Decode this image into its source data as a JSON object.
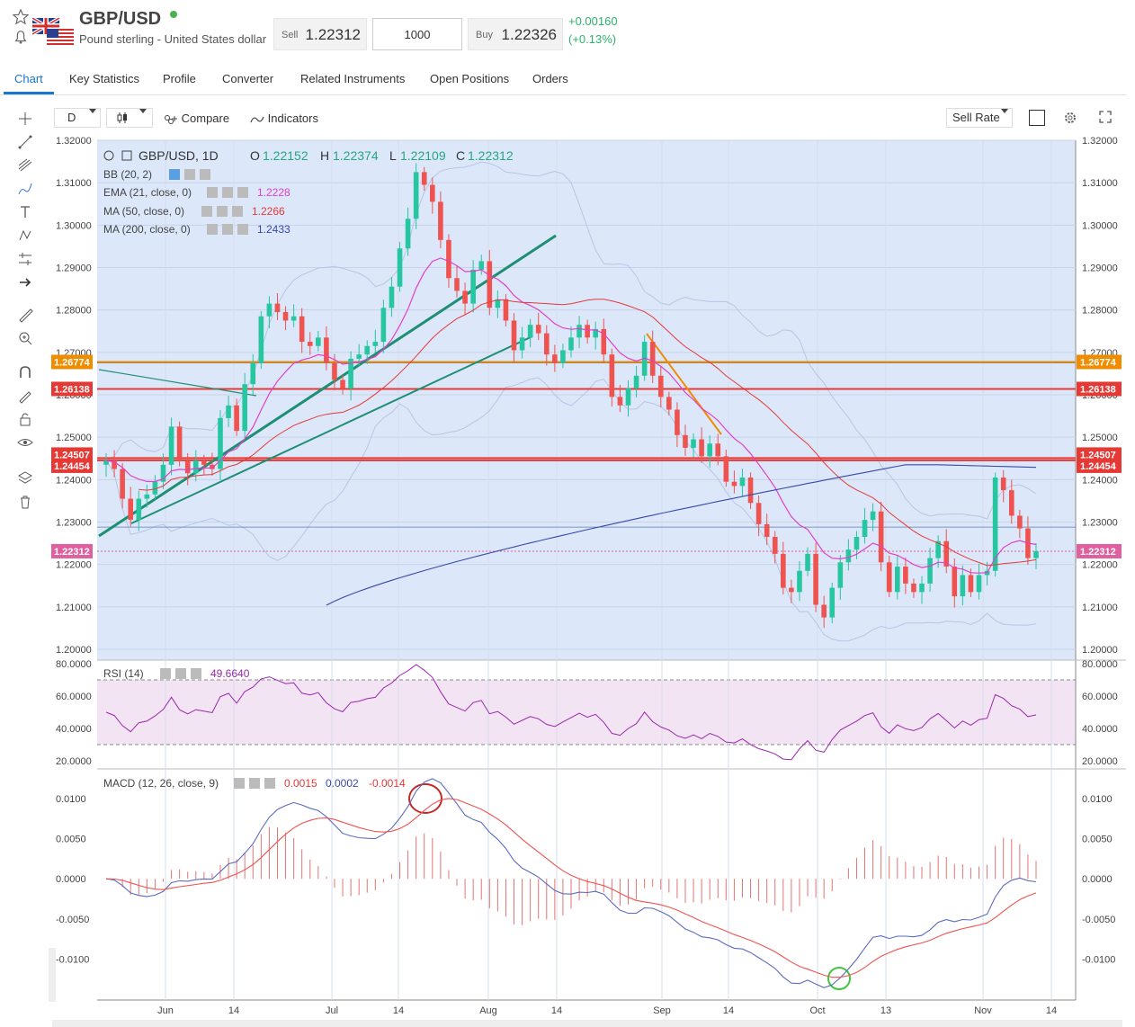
{
  "header": {
    "symbol": "GBP/USD",
    "name": "Pound sterling - United States dollar",
    "sell_label": "Sell",
    "sell_price": "1.22312",
    "quantity": "1000",
    "buy_label": "Buy",
    "buy_price": "1.22326",
    "change_abs": "+0.00160",
    "change_pct": "(+0.13%)"
  },
  "tabs": [
    {
      "label": "Chart",
      "active": true
    },
    {
      "label": "Key Statistics"
    },
    {
      "label": "Profile"
    },
    {
      "label": "Converter"
    },
    {
      "label": "Related Instruments"
    },
    {
      "label": "Open Positions"
    },
    {
      "label": "Orders"
    }
  ],
  "toolbar": {
    "interval": "D",
    "compare": "Compare",
    "indicators": "Indicators",
    "rate_mode": "Sell Rate"
  },
  "legend": {
    "title": "GBP/USD, 1D",
    "o_lbl": "O",
    "o": "1.22152",
    "h_lbl": "H",
    "h": "1.22374",
    "l_lbl": "L",
    "l": "1.22109",
    "c_lbl": "C",
    "c": "1.22312",
    "bb": "BB (20, 2)",
    "ema": "EMA (21, close, 0)",
    "ema_val": "1.2228",
    "ma50": "MA (50, close, 0)",
    "ma50_val": "1.2266",
    "ma200": "MA (200, close, 0)",
    "ma200_val": "1.2433",
    "rsi": "RSI (14)",
    "rsi_val": "49.6640",
    "macd": "MACD (12, 26, close, 9)",
    "macd_v1": "0.0015",
    "macd_v2": "0.0002",
    "macd_v3": "-0.0014"
  },
  "colors": {
    "up": "#26c6a0",
    "down": "#ef5350",
    "ema": "#e040c8",
    "ma50": "#e53935",
    "ma200": "#3949ab",
    "level_orange": "#ef8c00",
    "level_red": "#e53935",
    "trend": "#1e8f73"
  },
  "price_levels": [
    {
      "value": "1.26774",
      "color": "#ef8c00"
    },
    {
      "value": "1.26138",
      "color": "#e53935"
    },
    {
      "value": "1.24507",
      "color": "#e53935"
    },
    {
      "value": "1.24454",
      "color": "#e53935"
    },
    {
      "value": "1.22312",
      "color": "#e05f9f"
    }
  ],
  "chart_data": [
    {
      "type": "candlestick",
      "title": "GBP/USD, 1D",
      "ylim": [
        1.2,
        1.32
      ],
      "y_ticks": [
        "1.32000",
        "1.31000",
        "1.30000",
        "1.29000",
        "1.28000",
        "1.27000",
        "1.26000",
        "1.25000",
        "1.24000",
        "1.23000",
        "1.22000",
        "1.21000",
        "1.20000"
      ],
      "x_ticks": [
        "Jun",
        "14",
        "Jul",
        "14",
        "Aug",
        "14",
        "Sep",
        "14",
        "Oct",
        "13",
        "Nov",
        "14"
      ],
      "closes": [
        1.2445,
        1.2425,
        1.2355,
        1.2305,
        1.2355,
        1.2365,
        1.2395,
        1.2435,
        1.2525,
        1.2445,
        1.2415,
        1.2445,
        1.2435,
        1.2425,
        1.2545,
        1.2575,
        1.2515,
        1.2625,
        1.2675,
        1.2785,
        1.2815,
        1.2795,
        1.2775,
        1.2785,
        1.2725,
        1.2715,
        1.2735,
        1.2675,
        1.2635,
        1.2615,
        1.2685,
        1.2695,
        1.2715,
        1.2725,
        1.2805,
        1.2855,
        1.2945,
        1.3015,
        1.3125,
        1.3095,
        1.3055,
        1.2965,
        1.2875,
        1.2845,
        1.2815,
        1.2895,
        1.2915,
        1.2805,
        1.2825,
        1.2775,
        1.2705,
        1.2735,
        1.2765,
        1.2745,
        1.2695,
        1.2675,
        1.2705,
        1.2735,
        1.2765,
        1.2735,
        1.2755,
        1.2695,
        1.2595,
        1.2575,
        1.2615,
        1.2645,
        1.2725,
        1.2645,
        1.2595,
        1.2565,
        1.2505,
        1.2475,
        1.2495,
        1.2455,
        1.2485,
        1.2455,
        1.2395,
        1.2385,
        1.2405,
        1.2345,
        1.2295,
        1.2265,
        1.2225,
        1.2145,
        1.2135,
        1.2185,
        1.2225,
        1.2105,
        1.2075,
        1.2145,
        1.2205,
        1.2235,
        1.2265,
        1.2305,
        1.2325,
        1.2205,
        1.2135,
        1.2195,
        1.2155,
        1.2135,
        1.2155,
        1.2215,
        1.2255,
        1.2195,
        1.2125,
        1.2175,
        1.2135,
        1.2175,
        1.2185,
        1.2405,
        1.2375,
        1.2315,
        1.2285,
        1.2215,
        1.2231
      ]
    },
    {
      "type": "line",
      "title": "RSI (14)",
      "ylim": [
        20,
        80
      ],
      "y_ticks": [
        "80.0000",
        "60.0000",
        "40.0000",
        "20.0000"
      ]
    },
    {
      "type": "line",
      "title": "MACD (12, 26, close, 9)",
      "ylim": [
        -0.013,
        0.012
      ],
      "y_ticks": [
        "0.0100",
        "0.0050",
        "0.0000",
        "-0.0050",
        "-0.0100"
      ]
    }
  ]
}
